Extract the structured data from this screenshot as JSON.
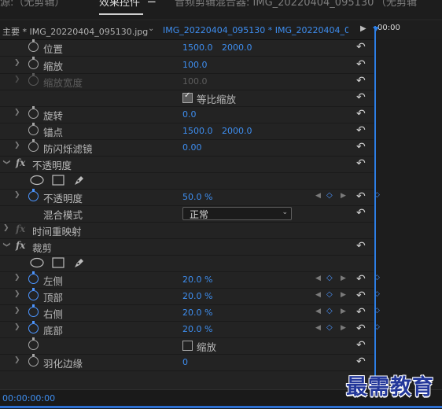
{
  "top_tabs": {
    "source": "源:（无剪辑）",
    "effect_controls": "效果控件",
    "menu_icon": "☰",
    "audio_mixer": "音频剪辑混合器: IMG_20220404_095130",
    "no_clip": "（无剪辑"
  },
  "header": {
    "master": "主要 * IMG_20220404_095130.jpg",
    "clip": "IMG_20220404_095130 * IMG_20220404_095...",
    "timecode": "00:00"
  },
  "rows": {
    "position": {
      "label": "位置",
      "x": "1500.0",
      "y": "2000.0"
    },
    "scale": {
      "label": "缩放",
      "value": "100.0"
    },
    "scale_width": {
      "label": "缩放宽度",
      "value": "100.0"
    },
    "uniform_scale": {
      "label": "等比缩放"
    },
    "rotation": {
      "label": "旋转",
      "value": "0.0"
    },
    "anchor": {
      "label": "锚点",
      "x": "1500.0",
      "y": "2000.0"
    },
    "anti_flicker": {
      "label": "防闪烁滤镜",
      "value": "0.00"
    },
    "opacity_section": {
      "fx": "fx",
      "label": "不透明度"
    },
    "opacity": {
      "label": "不透明度",
      "value": "50.0 %"
    },
    "blend_mode": {
      "label": "混合模式",
      "value": "正常"
    },
    "time_remap": {
      "fx": "fx",
      "label": "时间重映射"
    },
    "crop_section": {
      "fx": "fx",
      "label": "裁剪"
    },
    "left": {
      "label": "左侧",
      "value": "20.0 %"
    },
    "top": {
      "label": "顶部",
      "value": "20.0 %"
    },
    "right": {
      "label": "右侧",
      "value": "20.0 %"
    },
    "bottom": {
      "label": "底部",
      "value": "20.0 %"
    },
    "zoom": {
      "label": "缩放"
    },
    "feather": {
      "label": "羽化边缘",
      "value": "0"
    }
  },
  "footer": {
    "timecode": "00:00:00:00"
  },
  "watermark": "最需教育",
  "icons": {
    "reset": "reset-icon",
    "stopwatch": "stopwatch-icon",
    "expand": "chevron-right-icon",
    "ellipse_mask": "ellipse-mask-icon",
    "rect_mask": "rectangle-mask-icon",
    "pen_mask": "pen-mask-icon"
  },
  "colors": {
    "accent": "#3e8ef0",
    "background": "#232323",
    "watermark": "#23379a"
  }
}
